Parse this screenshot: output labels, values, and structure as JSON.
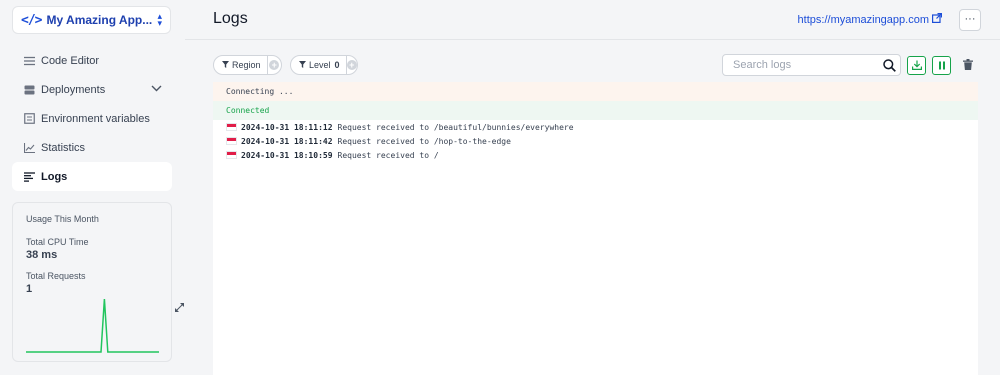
{
  "app": {
    "name": "My Amazing App...",
    "switcher_icon": "code-icon"
  },
  "sidebar": {
    "items": [
      {
        "label": "Code Editor",
        "icon": "list-icon"
      },
      {
        "label": "Deployments",
        "icon": "server-icon"
      },
      {
        "label": "Environment variables",
        "icon": "variables-icon"
      },
      {
        "label": "Statistics",
        "icon": "chart-line-icon"
      },
      {
        "label": "Logs",
        "icon": "logs-icon",
        "active": true
      }
    ]
  },
  "usage": {
    "title": "Usage This Month",
    "cpu_label": "Total CPU Time",
    "cpu_value": "38 ms",
    "requests_label": "Total Requests",
    "requests_value": "1",
    "sparkline_color": "#22c55e",
    "sparkline_values": [
      0,
      0,
      0,
      0,
      0,
      0,
      0,
      0,
      0,
      0,
      0,
      0,
      0,
      0,
      0,
      0,
      0,
      0,
      0,
      0,
      0,
      0,
      0,
      1,
      0,
      0,
      0,
      0,
      0,
      0,
      0,
      0,
      0,
      0,
      0,
      0,
      0,
      0,
      0,
      0
    ]
  },
  "header": {
    "title": "Logs",
    "link_text": "https://myamazingapp.com",
    "more_label": "···"
  },
  "toolbar": {
    "region_label": "Region",
    "level_label": "Level",
    "level_count": "0",
    "search_placeholder": "Search logs"
  },
  "logs": {
    "connecting": "Connecting ...",
    "connected": "Connected",
    "entries": [
      {
        "timestamp": "2024-10-31 18:11:12",
        "message": "Request received to /beautiful/bunnies/everywhere"
      },
      {
        "timestamp": "2024-10-31 18:11:42",
        "message": "Request received to /hop-to-the-edge"
      },
      {
        "timestamp": "2024-10-31 18:10:59",
        "message": "Request received to /"
      }
    ]
  },
  "colors": {
    "accent": "#1d4ed8",
    "success": "#16a34a"
  }
}
